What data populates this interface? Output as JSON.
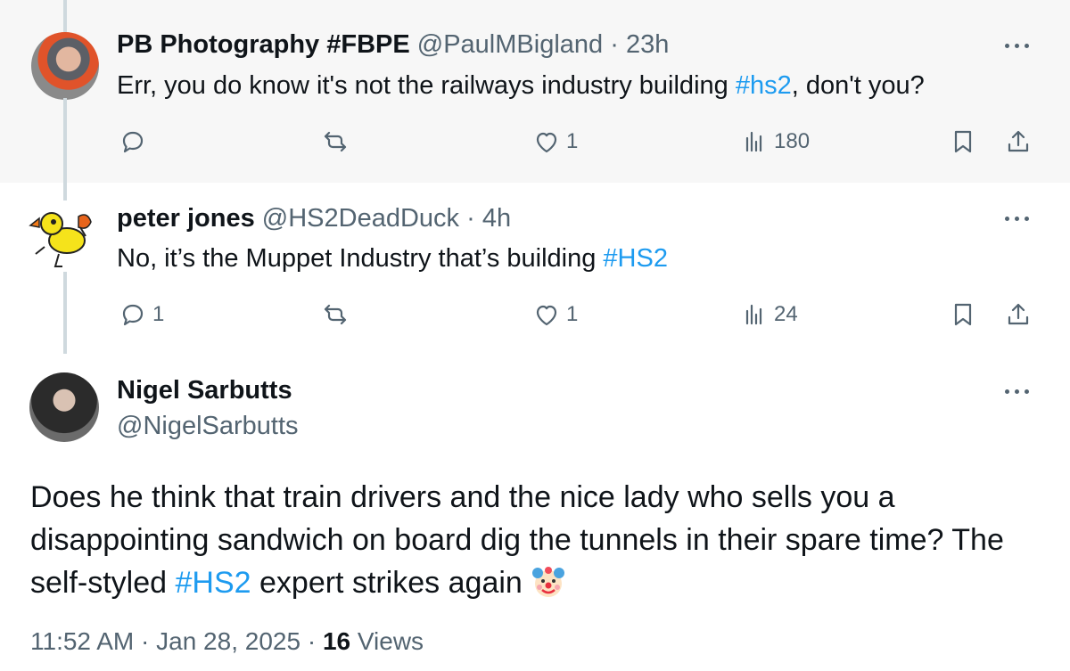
{
  "replies": [
    {
      "name": "PB Photography #FBPE",
      "handle": "@PaulMBigland",
      "sep": "·",
      "time": "23h",
      "text_before": "Err, you do know it's not the railways industry building ",
      "hashtag": "#hs2",
      "text_after": ", don't you?",
      "actions": {
        "replies": "",
        "reposts": "",
        "likes": "1",
        "views": "180"
      }
    },
    {
      "name": "peter jones",
      "handle": "@HS2DeadDuck",
      "sep": "·",
      "time": "4h",
      "text_before": "No, it’s the Muppet Industry that’s building ",
      "hashtag": "#HS2",
      "text_after": "",
      "actions": {
        "replies": "1",
        "reposts": "",
        "likes": "1",
        "views": "24"
      }
    }
  ],
  "main_post": {
    "name": "Nigel Sarbutts",
    "handle": "@NigelSarbutts",
    "line1": "Does he think that train drivers and the nice lady who sells you a",
    "line2": "disappointing sandwich on board dig the tunnels in their spare time? The",
    "line3_before": "self-styled ",
    "hashtag": "#HS2",
    "line3_after": " expert strikes again",
    "emoji_icon": "clown-face-icon",
    "time": "11:52 AM",
    "sep": "·",
    "date": "Jan 28, 2025",
    "views_count": "16",
    "views_label": "Views"
  },
  "colors": {
    "link": "#1d9bf0",
    "muted": "#536471",
    "text": "#0f1419",
    "thread_line": "#cfd9de"
  }
}
